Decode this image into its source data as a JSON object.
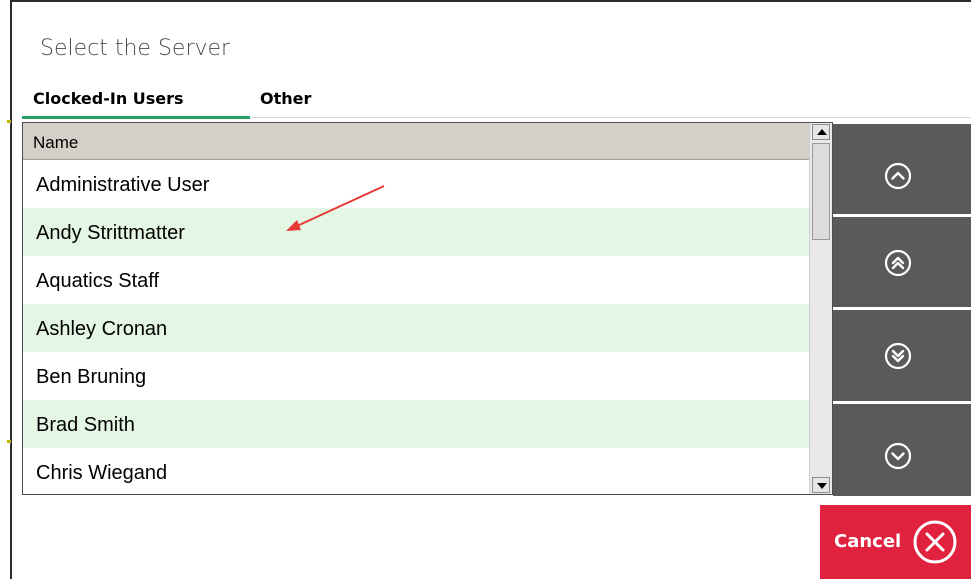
{
  "dialog": {
    "title": "Select the Server"
  },
  "tabs": [
    {
      "label": "Clocked-In Users",
      "selected": true
    },
    {
      "label": "Other",
      "selected": false
    }
  ],
  "list": {
    "column_header": "Name",
    "rows": [
      "Administrative User",
      "Andy Strittmatter",
      "Aquatics Staff",
      "Ashley Cronan",
      "Ben Bruning",
      "Brad Smith",
      "Chris Wiegand"
    ]
  },
  "nav_buttons": [
    {
      "icon": "chevron-up-icon"
    },
    {
      "icon": "double-chevron-up-icon"
    },
    {
      "icon": "double-chevron-down-icon"
    },
    {
      "icon": "chevron-down-icon"
    }
  ],
  "cancel": {
    "label": "Cancel",
    "icon": "close-circle-icon"
  },
  "colors": {
    "tab_underline": "#27a162",
    "row_alternate": "#e4f7e4",
    "nav_button": "#5a5a5a",
    "cancel_button": "#e0223f",
    "annotation_arrow": "#e53935"
  }
}
